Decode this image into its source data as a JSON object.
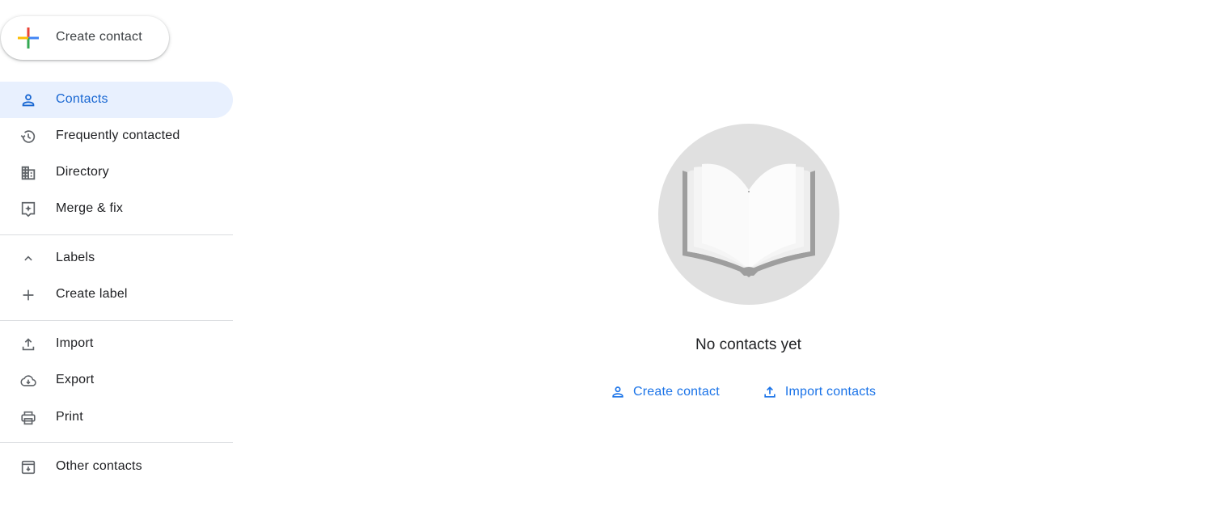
{
  "sidebar": {
    "create_button": {
      "label": "Create contact",
      "icon": "multicolor-plus-icon"
    },
    "items": [
      {
        "label": "Contacts",
        "icon": "person-icon",
        "active": true
      },
      {
        "label": "Frequently contacted",
        "icon": "history-icon",
        "active": false
      },
      {
        "label": "Directory",
        "icon": "building-icon",
        "active": false
      },
      {
        "label": "Merge & fix",
        "icon": "merge-fix-icon",
        "active": false
      }
    ],
    "labels_section": {
      "header": {
        "label": "Labels",
        "icon": "chevron-up-icon"
      },
      "create_label": {
        "label": "Create label",
        "icon": "plus-icon"
      }
    },
    "tools": [
      {
        "label": "Import",
        "icon": "upload-icon"
      },
      {
        "label": "Export",
        "icon": "cloud-download-icon"
      },
      {
        "label": "Print",
        "icon": "print-icon"
      }
    ],
    "other": {
      "label": "Other contacts",
      "icon": "archive-download-icon"
    }
  },
  "empty_state": {
    "illustration": "open-book-illustration",
    "title": "No contacts yet",
    "actions": [
      {
        "label": "Create contact",
        "icon": "person-icon"
      },
      {
        "label": "Import contacts",
        "icon": "upload-icon"
      }
    ]
  },
  "colors": {
    "accent": "#1a73e8",
    "active_bg": "#e8f0fe",
    "active_text": "#1967d2",
    "icon_gray": "#5f6368",
    "divider": "#dadce0",
    "illustration_bg": "#e0e0e0",
    "plus_red": "#ea4335",
    "plus_blue": "#4285f4",
    "plus_green": "#34a853",
    "plus_yellow": "#fbbc04"
  }
}
